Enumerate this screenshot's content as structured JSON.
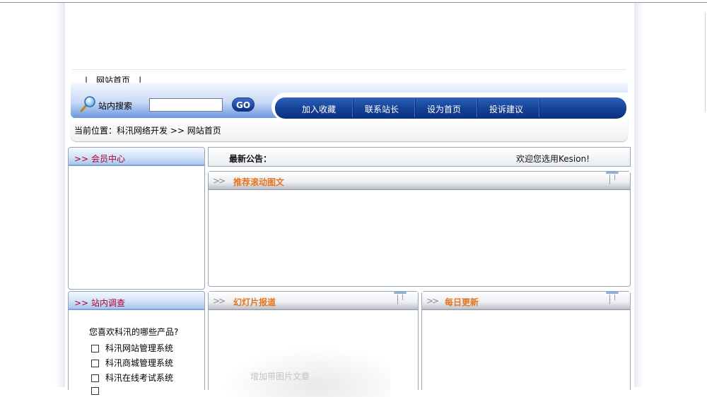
{
  "header": {
    "toplinks": {
      "sep_left": "|",
      "home": "网站首页",
      "sep_right": "|"
    },
    "search": {
      "label": "站内搜索",
      "value": "",
      "go_label": "GO"
    },
    "nav": [
      "加入收藏",
      "联系站长",
      "设为首页",
      "投诉建议"
    ]
  },
  "breadcrumb": {
    "prefix": "当前位置：",
    "site": "科汛网络开发",
    "sep": ">>",
    "current": "网站首页"
  },
  "sidebar": {
    "member": {
      "arrow": ">>",
      "title": "会员中心"
    },
    "survey": {
      "arrow": ">>",
      "title": "站内调查",
      "question": "您喜欢科汛的哪些产品?",
      "options": [
        "科汛网站管理系统",
        "科汛商城管理系统",
        "科汛在线考试系统"
      ]
    }
  },
  "notice": {
    "label": "最新公告：",
    "message": "欢迎您选用Kesion!"
  },
  "boxes": {
    "recommend": {
      "title": "推荐滚动图文"
    },
    "slideshow": {
      "title": "幻灯片报道"
    },
    "daily": {
      "title": "每日更新"
    }
  },
  "placeholder": {
    "watermark": "增加带图片文章"
  },
  "icons": [
    "search-icon",
    "chevron-icon",
    "tab-handle-icon"
  ],
  "colors": {
    "accent_red": "#b0002a",
    "title_orange": "#e5741c",
    "nav_blue": "#154396"
  }
}
